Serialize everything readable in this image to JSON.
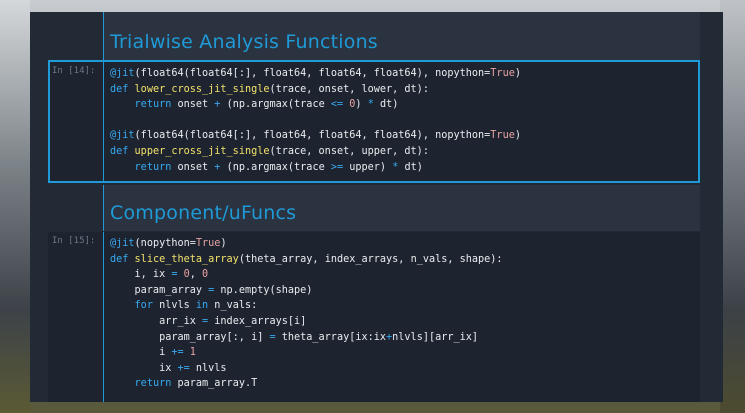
{
  "sections": [
    {
      "title": "Trialwise Analysis Functions"
    },
    {
      "title": "Component/uFuncs"
    }
  ],
  "cells": [
    {
      "prompt": "In [14]:",
      "lines": [
        [
          {
            "t": "@jit",
            "c": "dec"
          },
          {
            "t": "(float64(float64[:], float64, float64, float64), nopython=",
            "c": ""
          },
          {
            "t": "True",
            "c": "tru"
          },
          {
            "t": ")",
            "c": ""
          }
        ],
        [
          {
            "t": "def ",
            "c": "kw"
          },
          {
            "t": "lower_cross_jit_single",
            "c": "fn"
          },
          {
            "t": "(trace, onset, lower, dt):",
            "c": ""
          }
        ],
        [
          {
            "t": "    ",
            "c": ""
          },
          {
            "t": "return",
            "c": "kw"
          },
          {
            "t": " onset ",
            "c": ""
          },
          {
            "t": "+",
            "c": "op"
          },
          {
            "t": " (np.argmax(trace ",
            "c": ""
          },
          {
            "t": "<=",
            "c": "op"
          },
          {
            "t": " ",
            "c": ""
          },
          {
            "t": "0",
            "c": "num"
          },
          {
            "t": ") ",
            "c": ""
          },
          {
            "t": "*",
            "c": "op"
          },
          {
            "t": " dt)",
            "c": ""
          }
        ],
        [],
        [
          {
            "t": "@jit",
            "c": "dec"
          },
          {
            "t": "(float64(float64[:], float64, float64, float64), nopython=",
            "c": ""
          },
          {
            "t": "True",
            "c": "tru"
          },
          {
            "t": ")",
            "c": ""
          }
        ],
        [
          {
            "t": "def ",
            "c": "kw"
          },
          {
            "t": "upper_cross_jit_single",
            "c": "fn"
          },
          {
            "t": "(trace, onset, upper, dt):",
            "c": ""
          }
        ],
        [
          {
            "t": "    ",
            "c": ""
          },
          {
            "t": "return",
            "c": "kw"
          },
          {
            "t": " onset ",
            "c": ""
          },
          {
            "t": "+",
            "c": "op"
          },
          {
            "t": " (np.argmax(trace ",
            "c": ""
          },
          {
            "t": ">=",
            "c": "op"
          },
          {
            "t": " upper) ",
            "c": ""
          },
          {
            "t": "*",
            "c": "op"
          },
          {
            "t": " dt)",
            "c": ""
          }
        ]
      ]
    },
    {
      "prompt": "In [15]:",
      "lines": [
        [
          {
            "t": "@jit",
            "c": "dec"
          },
          {
            "t": "(nopython=",
            "c": ""
          },
          {
            "t": "True",
            "c": "tru"
          },
          {
            "t": ")",
            "c": ""
          }
        ],
        [
          {
            "t": "def ",
            "c": "kw"
          },
          {
            "t": "slice_theta_array",
            "c": "fn"
          },
          {
            "t": "(theta_array, index_arrays, n_vals, shape):",
            "c": ""
          }
        ],
        [
          {
            "t": "    i, ix ",
            "c": ""
          },
          {
            "t": "=",
            "c": "op"
          },
          {
            "t": " ",
            "c": ""
          },
          {
            "t": "0",
            "c": "num"
          },
          {
            "t": ", ",
            "c": ""
          },
          {
            "t": "0",
            "c": "num"
          }
        ],
        [
          {
            "t": "    param_array ",
            "c": ""
          },
          {
            "t": "=",
            "c": "op"
          },
          {
            "t": " np.empty(shape)",
            "c": ""
          }
        ],
        [
          {
            "t": "    ",
            "c": ""
          },
          {
            "t": "for",
            "c": "kw"
          },
          {
            "t": " nlvls ",
            "c": ""
          },
          {
            "t": "in",
            "c": "kw"
          },
          {
            "t": " n_vals:",
            "c": ""
          }
        ],
        [
          {
            "t": "        arr_ix ",
            "c": ""
          },
          {
            "t": "=",
            "c": "op"
          },
          {
            "t": " index_arrays[i]",
            "c": ""
          }
        ],
        [
          {
            "t": "        param_array[:, i] ",
            "c": ""
          },
          {
            "t": "=",
            "c": "op"
          },
          {
            "t": " theta_array[ix:ix",
            "c": ""
          },
          {
            "t": "+",
            "c": "op"
          },
          {
            "t": "nlvls][arr_ix]",
            "c": ""
          }
        ],
        [
          {
            "t": "        i ",
            "c": ""
          },
          {
            "t": "+=",
            "c": "op"
          },
          {
            "t": " ",
            "c": ""
          },
          {
            "t": "1",
            "c": "num"
          }
        ],
        [
          {
            "t": "        ix ",
            "c": ""
          },
          {
            "t": "+=",
            "c": "op"
          },
          {
            "t": " nlvls",
            "c": ""
          }
        ],
        [
          {
            "t": "    ",
            "c": ""
          },
          {
            "t": "return",
            "c": "kw"
          },
          {
            "t": " param_array.T",
            "c": ""
          }
        ]
      ]
    }
  ]
}
